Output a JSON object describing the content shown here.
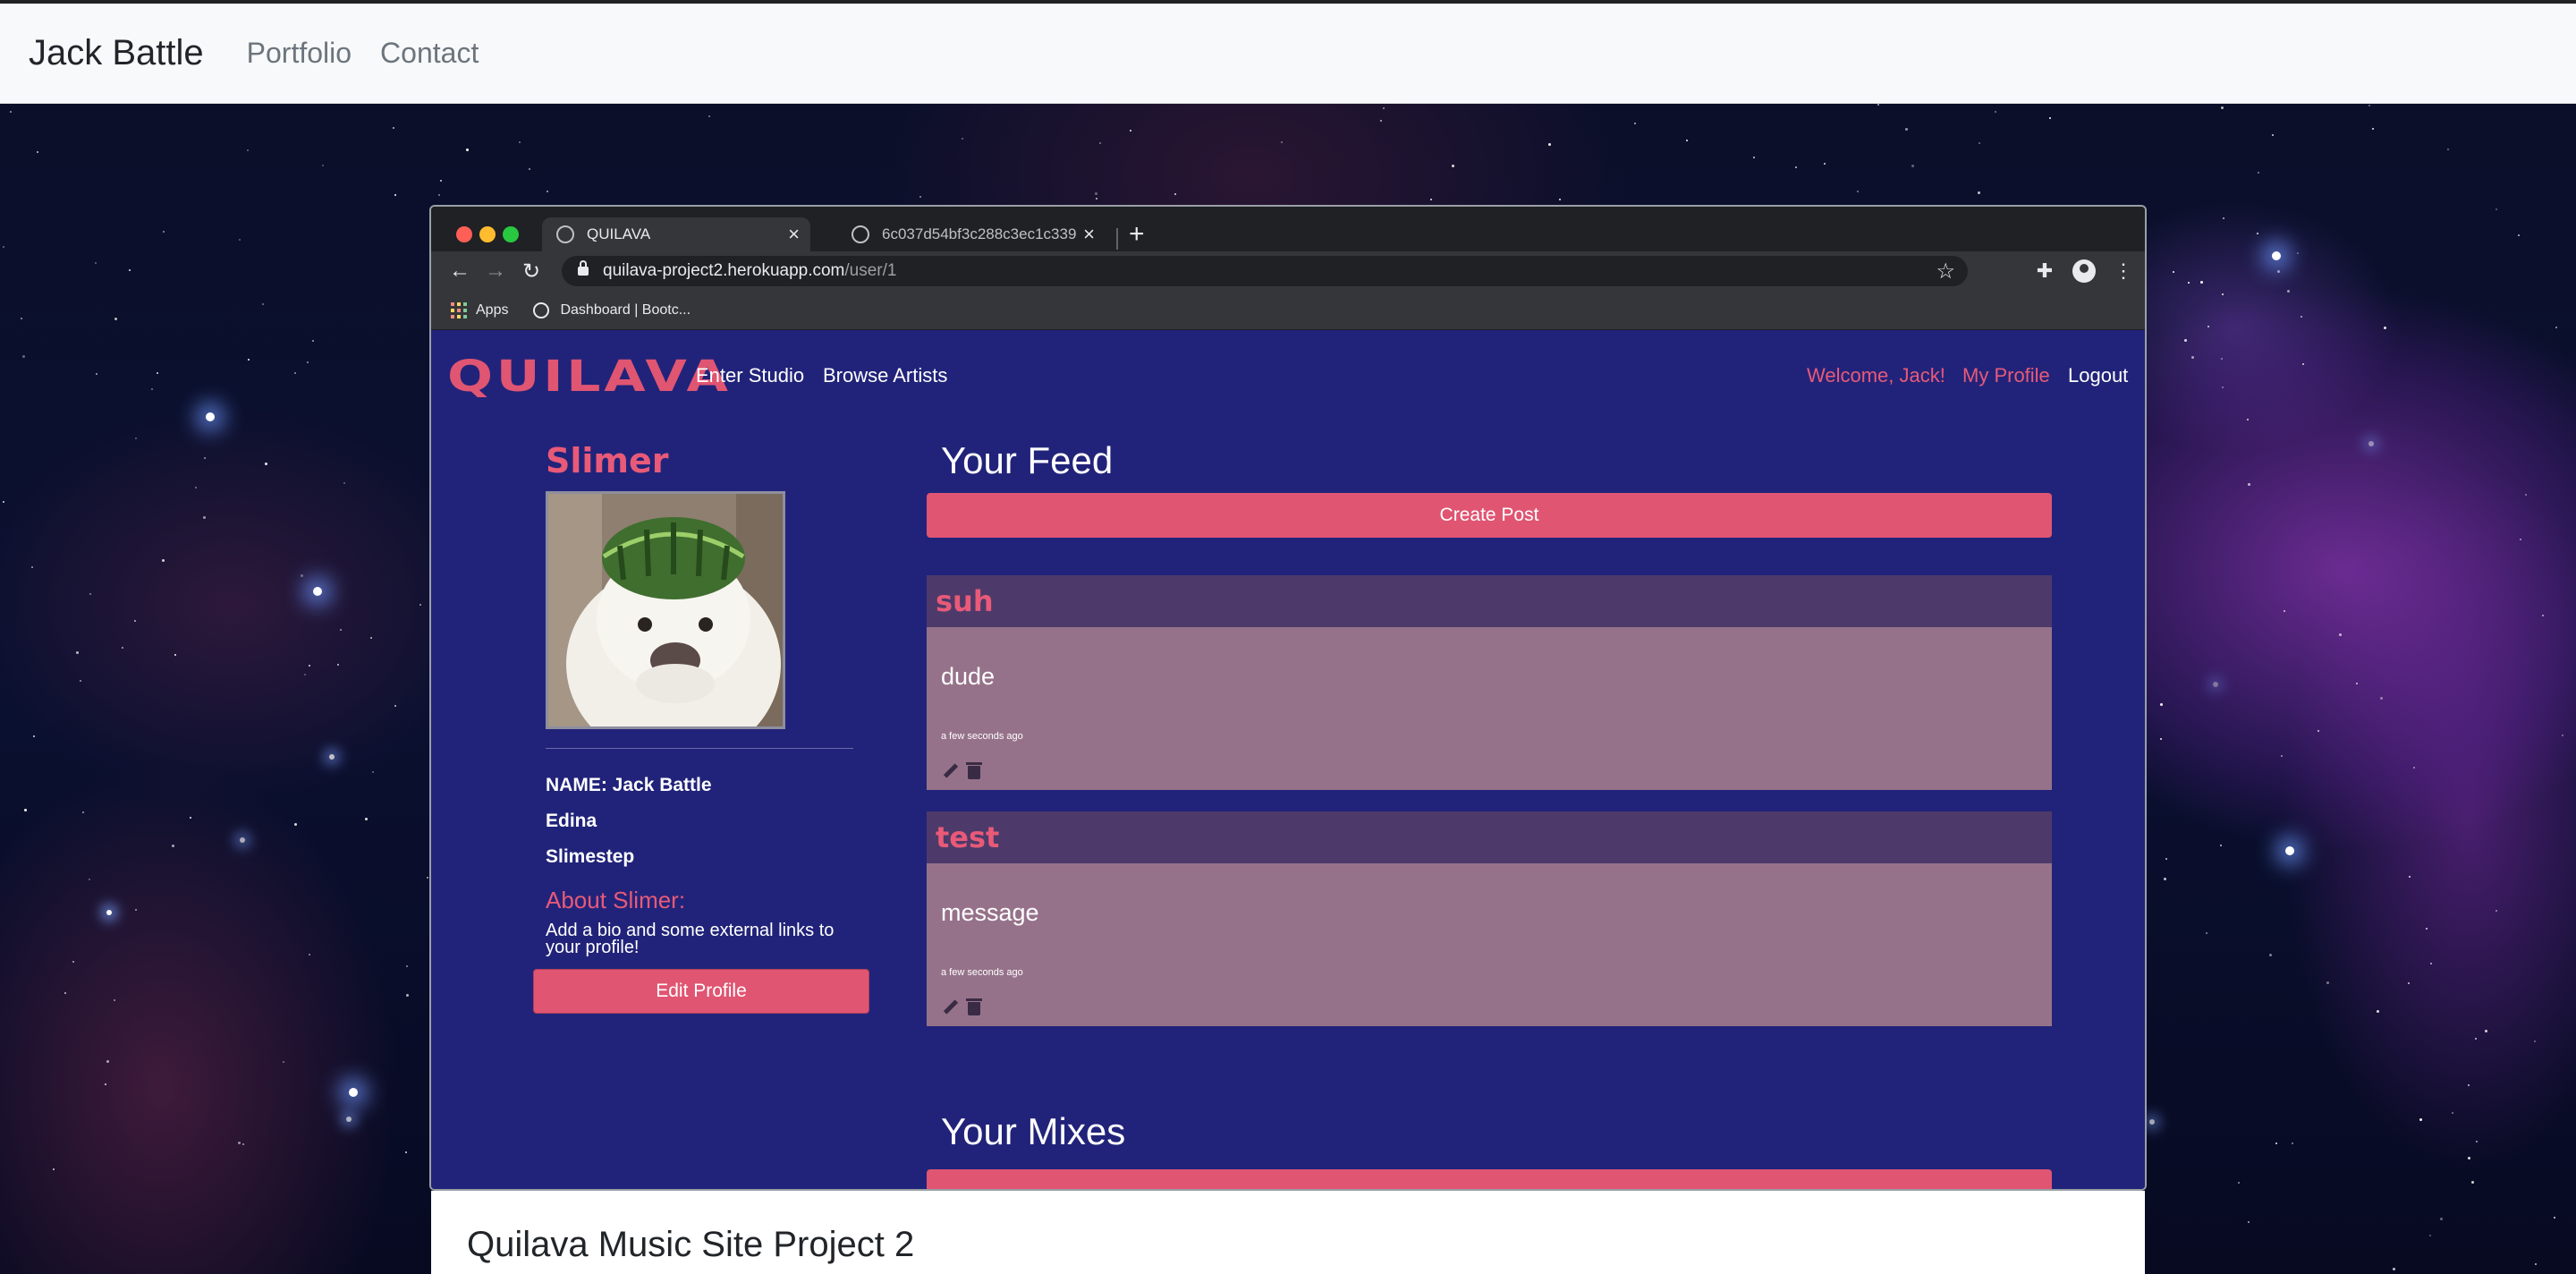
{
  "site": {
    "brand": "Jack Battle",
    "nav": [
      "Portfolio",
      "Contact"
    ]
  },
  "browser": {
    "tabs": [
      {
        "title": "QUILAVA",
        "active": true
      },
      {
        "title": "6c037d54bf3c288c3ec1c339",
        "active": false
      }
    ],
    "url_host": "quilava-project2.herokuapp.com",
    "url_path": "/user/1",
    "bookmarks": [
      "Apps",
      "Dashboard | Bootc..."
    ]
  },
  "app": {
    "logo": "QUILAVA",
    "nav_left": [
      "Enter Studio",
      "Browse Artists"
    ],
    "nav_right": [
      "Welcome, Jack!",
      "My Profile",
      "Logout"
    ],
    "profile": {
      "username": "Slimer",
      "name_line": "NAME: Jack Battle",
      "location": "Edina",
      "genre": "Slimestep",
      "about_heading": "About Slimer:",
      "about_text": "Add a bio and some external links to your profile!",
      "edit_button": "Edit Profile"
    },
    "feed": {
      "title": "Your Feed",
      "create_button": "Create Post",
      "posts": [
        {
          "title": "suh",
          "message": "dude",
          "time": "a few seconds ago"
        },
        {
          "title": "test",
          "message": "message",
          "time": "a few seconds ago"
        }
      ]
    },
    "mixes_title": "Your Mixes"
  },
  "card": {
    "title": "Quilava Music Site Project 2"
  },
  "colors": {
    "app_bg": "#21237a",
    "accent_pink": "#e05572",
    "post_header": "#4d3a6a",
    "post_body": "#96728a"
  }
}
